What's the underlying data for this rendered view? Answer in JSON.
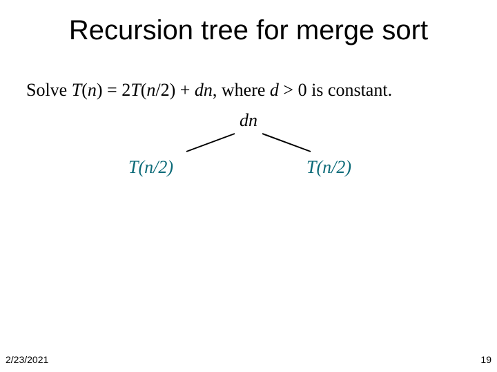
{
  "title": "Recursion tree for merge sort",
  "equation": {
    "prefix": "Solve ",
    "Tn": "T",
    "lp1": "(",
    "n1": "n",
    "rp1": ")",
    "eq": " = 2",
    "Tn2": "T",
    "lp2": "(",
    "n2": "n",
    "over2a": "/2) + ",
    "d": "d",
    "n3": "n",
    "mid": ", where ",
    "d2": "d",
    "gt": " > 0 is constant."
  },
  "tree": {
    "root": "dn",
    "left": "T(n/2)",
    "right": "T(n/2)"
  },
  "footer": {
    "date": "2/23/2021",
    "page": "19"
  }
}
